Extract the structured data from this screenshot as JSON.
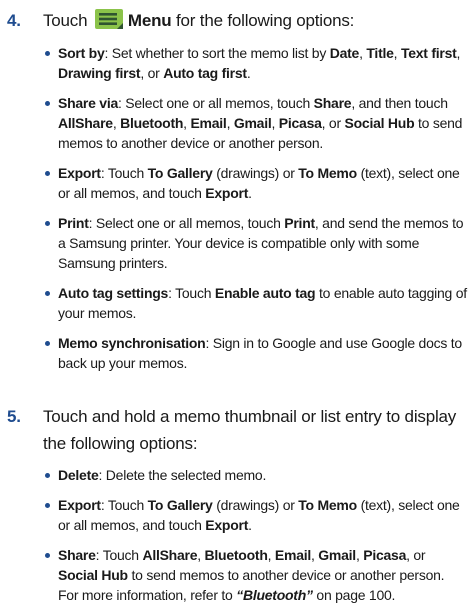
{
  "step4": {
    "number": "4.",
    "pre": "Touch",
    "menu_label": "Menu",
    "post": "for the following options:",
    "menu_icon": "menu-hamburger-icon",
    "items": [
      {
        "term": "Sort by",
        "text_a": ": Set whether to sort the memo list by ",
        "opt1": "Date",
        "sep1": ", ",
        "opt2": "Title",
        "sep2": ", ",
        "opt3": "Text first",
        "sep3": ", ",
        "opt4": "Drawing first",
        "sep4": ", or ",
        "opt5": "Auto tag first",
        "end": "."
      },
      {
        "term": "Share via",
        "text_a": ": Select one or all memos, touch ",
        "share": "Share",
        "text_b": ", and then touch ",
        "o1": "AllShare",
        "s1": ", ",
        "o2": "Bluetooth",
        "s2": ", ",
        "o3": "Email",
        "s3": ", ",
        "o4": "Gmail",
        "s4": ", ",
        "o5": "Picasa",
        "s5": ", or ",
        "o6": "Social Hub",
        "text_c": " to send memos to another device or another person."
      },
      {
        "term": "Export",
        "text_a": ": Touch ",
        "gallery": "To Gallery",
        "text_b": " (drawings) or ",
        "memo": "To Memo",
        "text_c": " (text), select one or all memos, and touch ",
        "export": "Export",
        "end": "."
      },
      {
        "term": "Print",
        "text_a": ": Select one or all memos, touch ",
        "print": "Print",
        "text_b": ", and send the memos to a Samsung printer. Your device is compatible only with some Samsung printers."
      },
      {
        "term": "Auto tag settings",
        "text_a": ": Touch ",
        "enable": "Enable auto tag",
        "text_b": " to enable auto tagging of your memos."
      },
      {
        "term": "Memo synchronisation",
        "text_a": ": Sign in to Google and use Google docs to back up your memos."
      }
    ]
  },
  "step5": {
    "number": "5.",
    "line1": "Touch and hold a memo thumbnail or list entry to display",
    "line2": "the following options:",
    "items": [
      {
        "term": "Delete",
        "text_a": ": Delete the selected memo."
      },
      {
        "term": "Export",
        "text_a": ": Touch ",
        "gallery": "To Gallery",
        "text_b": " (drawings) or ",
        "memo": "To Memo",
        "text_c": " (text), select one or all memos, and touch ",
        "export": "Export",
        "end": "."
      },
      {
        "term": "Share",
        "text_a": ": Touch ",
        "o1": "AllShare",
        "s1": ", ",
        "o2": "Bluetooth",
        "s2": ", ",
        "o3": "Email",
        "s3": ", ",
        "o4": "Gmail",
        "s4": ", ",
        "o5": "Picasa",
        "s5": ", or ",
        "o6": "Social Hub",
        "text_b": " to send memos to another device or another person. For more information, refer to ",
        "ref": "“Bluetooth”",
        "text_c": " on page 100."
      }
    ]
  },
  "colors": {
    "accent": "#1f4c8f",
    "icon_green": "#8bc34a",
    "icon_dark": "#2f5430"
  }
}
